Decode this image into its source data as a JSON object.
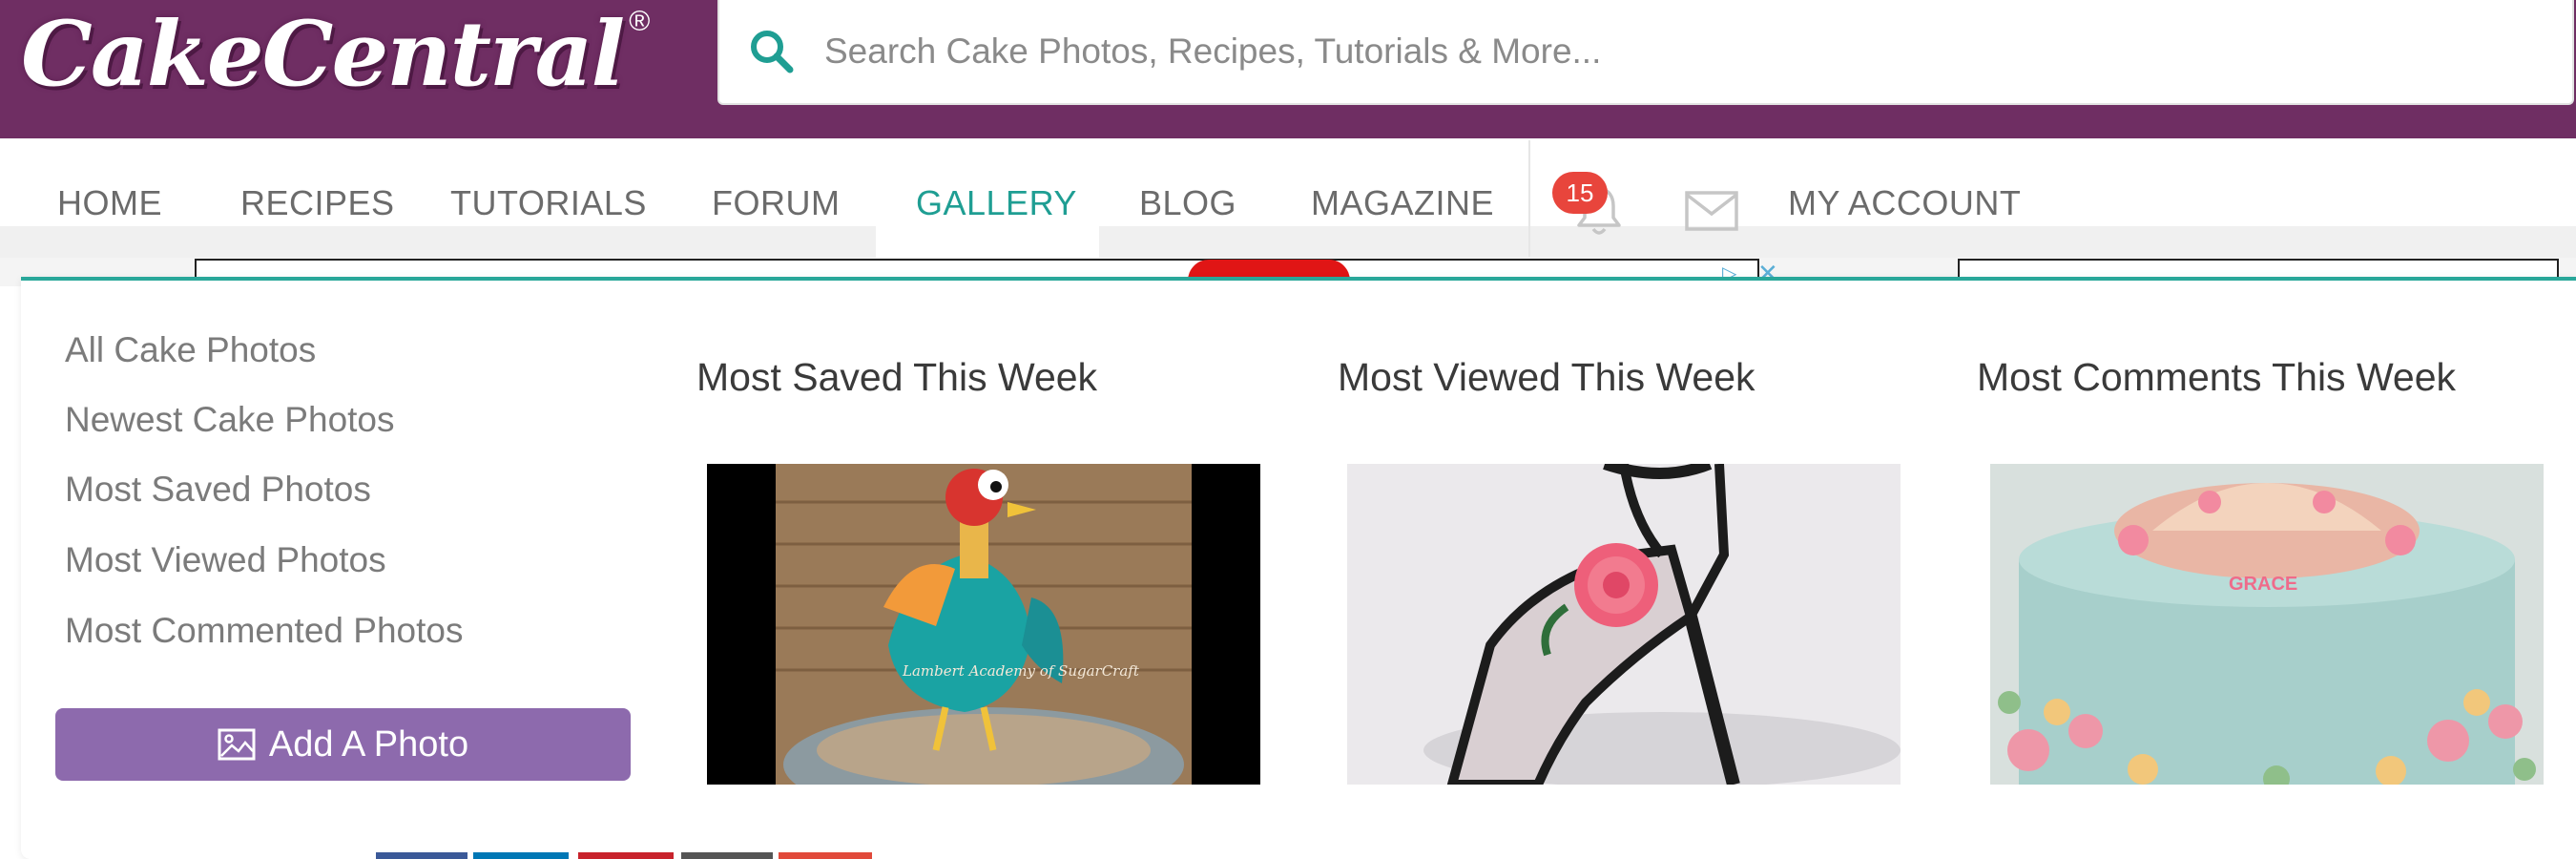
{
  "brand": {
    "name": "CakeCentral",
    "registered": "®"
  },
  "search": {
    "placeholder": "Search Cake Photos, Recipes, Tutorials & More..."
  },
  "nav": {
    "items": [
      "HOME",
      "RECIPES",
      "TUTORIALS",
      "FORUM",
      "GALLERY",
      "BLOG",
      "MAGAZINE"
    ],
    "active": "GALLERY",
    "notifications_count": "15",
    "account_label": "MY ACCOUNT"
  },
  "gallery_menu": {
    "links": [
      "All Cake Photos",
      "Newest Cake Photos",
      "Most Saved Photos",
      "Most Viewed Photos",
      "Most Commented Photos"
    ],
    "add_photo_label": "Add A Photo",
    "columns": [
      {
        "title": "Most Saved This Week",
        "image": "rooster-cake-photo",
        "watermark": "Lambert Academy of SugarCraft"
      },
      {
        "title": "Most Viewed This Week",
        "image": "high-heel-shoe-cake-photo"
      },
      {
        "title": "Most Comments This Week",
        "image": "blue-ocean-cake-photo",
        "cake_name": "GRACE"
      }
    ]
  },
  "colors": {
    "header": "#6f2e63",
    "accent": "#1f9e93",
    "button": "#8d6aad",
    "badge": "#e8453c"
  }
}
